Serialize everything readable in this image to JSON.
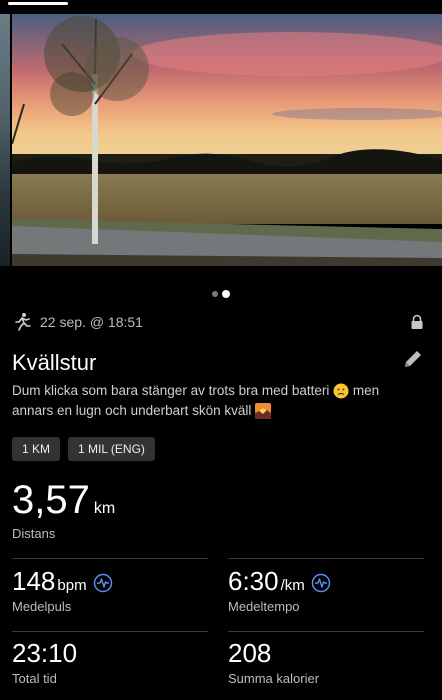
{
  "activity": {
    "date": "22 sep. @ 18:51",
    "title": "Kvällstur",
    "description": "Dum klicka som bara stänger av trots bra med batteri",
    "description_mid": " men annars en lugn och underbart skön kväll ",
    "emoji_1": "confused-face",
    "emoji_2": "sunset-emoji"
  },
  "split_chips": [
    "1 KM",
    "1 MIL (ENG)"
  ],
  "distance": {
    "value": "3,57",
    "unit": "km",
    "label": "Distans"
  },
  "stats": {
    "heart_rate": {
      "value": "148",
      "unit": "bpm",
      "label": "Medelpuls"
    },
    "pace": {
      "value": "6:30",
      "unit": "/km",
      "label": "Medeltempo"
    },
    "total_time": {
      "value": "23:10",
      "label": "Total tid"
    },
    "calories": {
      "value": "208",
      "label": "Summa kalorier"
    }
  },
  "photo_carousel": {
    "count": 2,
    "active_index": 2
  },
  "colors": {
    "background": "#000000",
    "accent": "#5b8def",
    "chip_bg": "#333333",
    "label_grey": "#bdbdbd"
  }
}
